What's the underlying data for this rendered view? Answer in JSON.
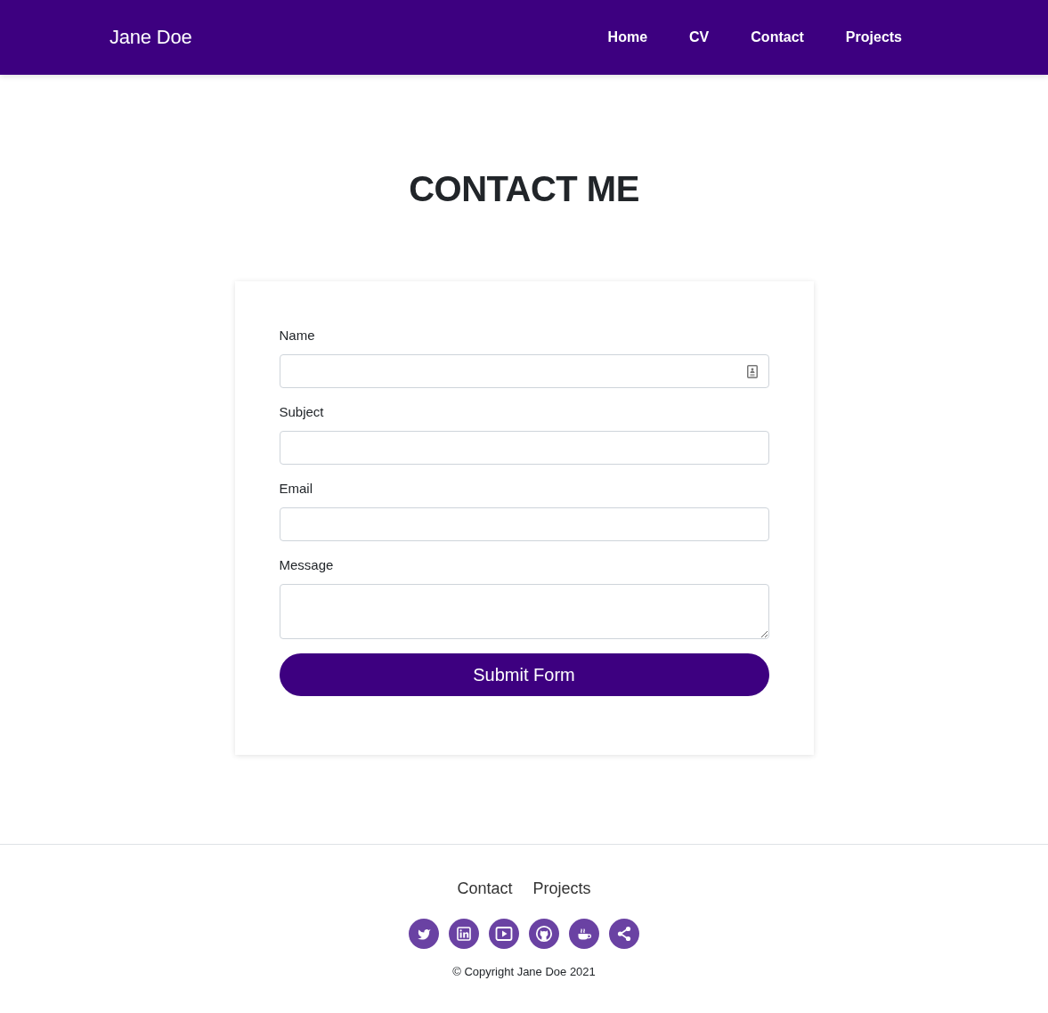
{
  "header": {
    "brand": "Jane Doe",
    "nav": [
      "Home",
      "CV",
      "Contact",
      "Projects"
    ]
  },
  "page_title": "CONTACT ME",
  "form": {
    "fields": [
      {
        "label": "Name",
        "kind": "input",
        "autofill": true
      },
      {
        "label": "Subject",
        "kind": "input",
        "autofill": false
      },
      {
        "label": "Email",
        "kind": "input",
        "autofill": false
      },
      {
        "label": "Message",
        "kind": "textarea",
        "autofill": false
      }
    ],
    "submit": "Submit Form"
  },
  "footer": {
    "links": [
      "Contact",
      "Projects"
    ],
    "social": [
      {
        "kind": "bird"
      },
      {
        "kind": "in-square"
      },
      {
        "kind": "play"
      },
      {
        "kind": "cat"
      },
      {
        "kind": "cup"
      },
      {
        "kind": "share"
      }
    ],
    "copyright": "© Copyright Jane Doe 2021"
  }
}
